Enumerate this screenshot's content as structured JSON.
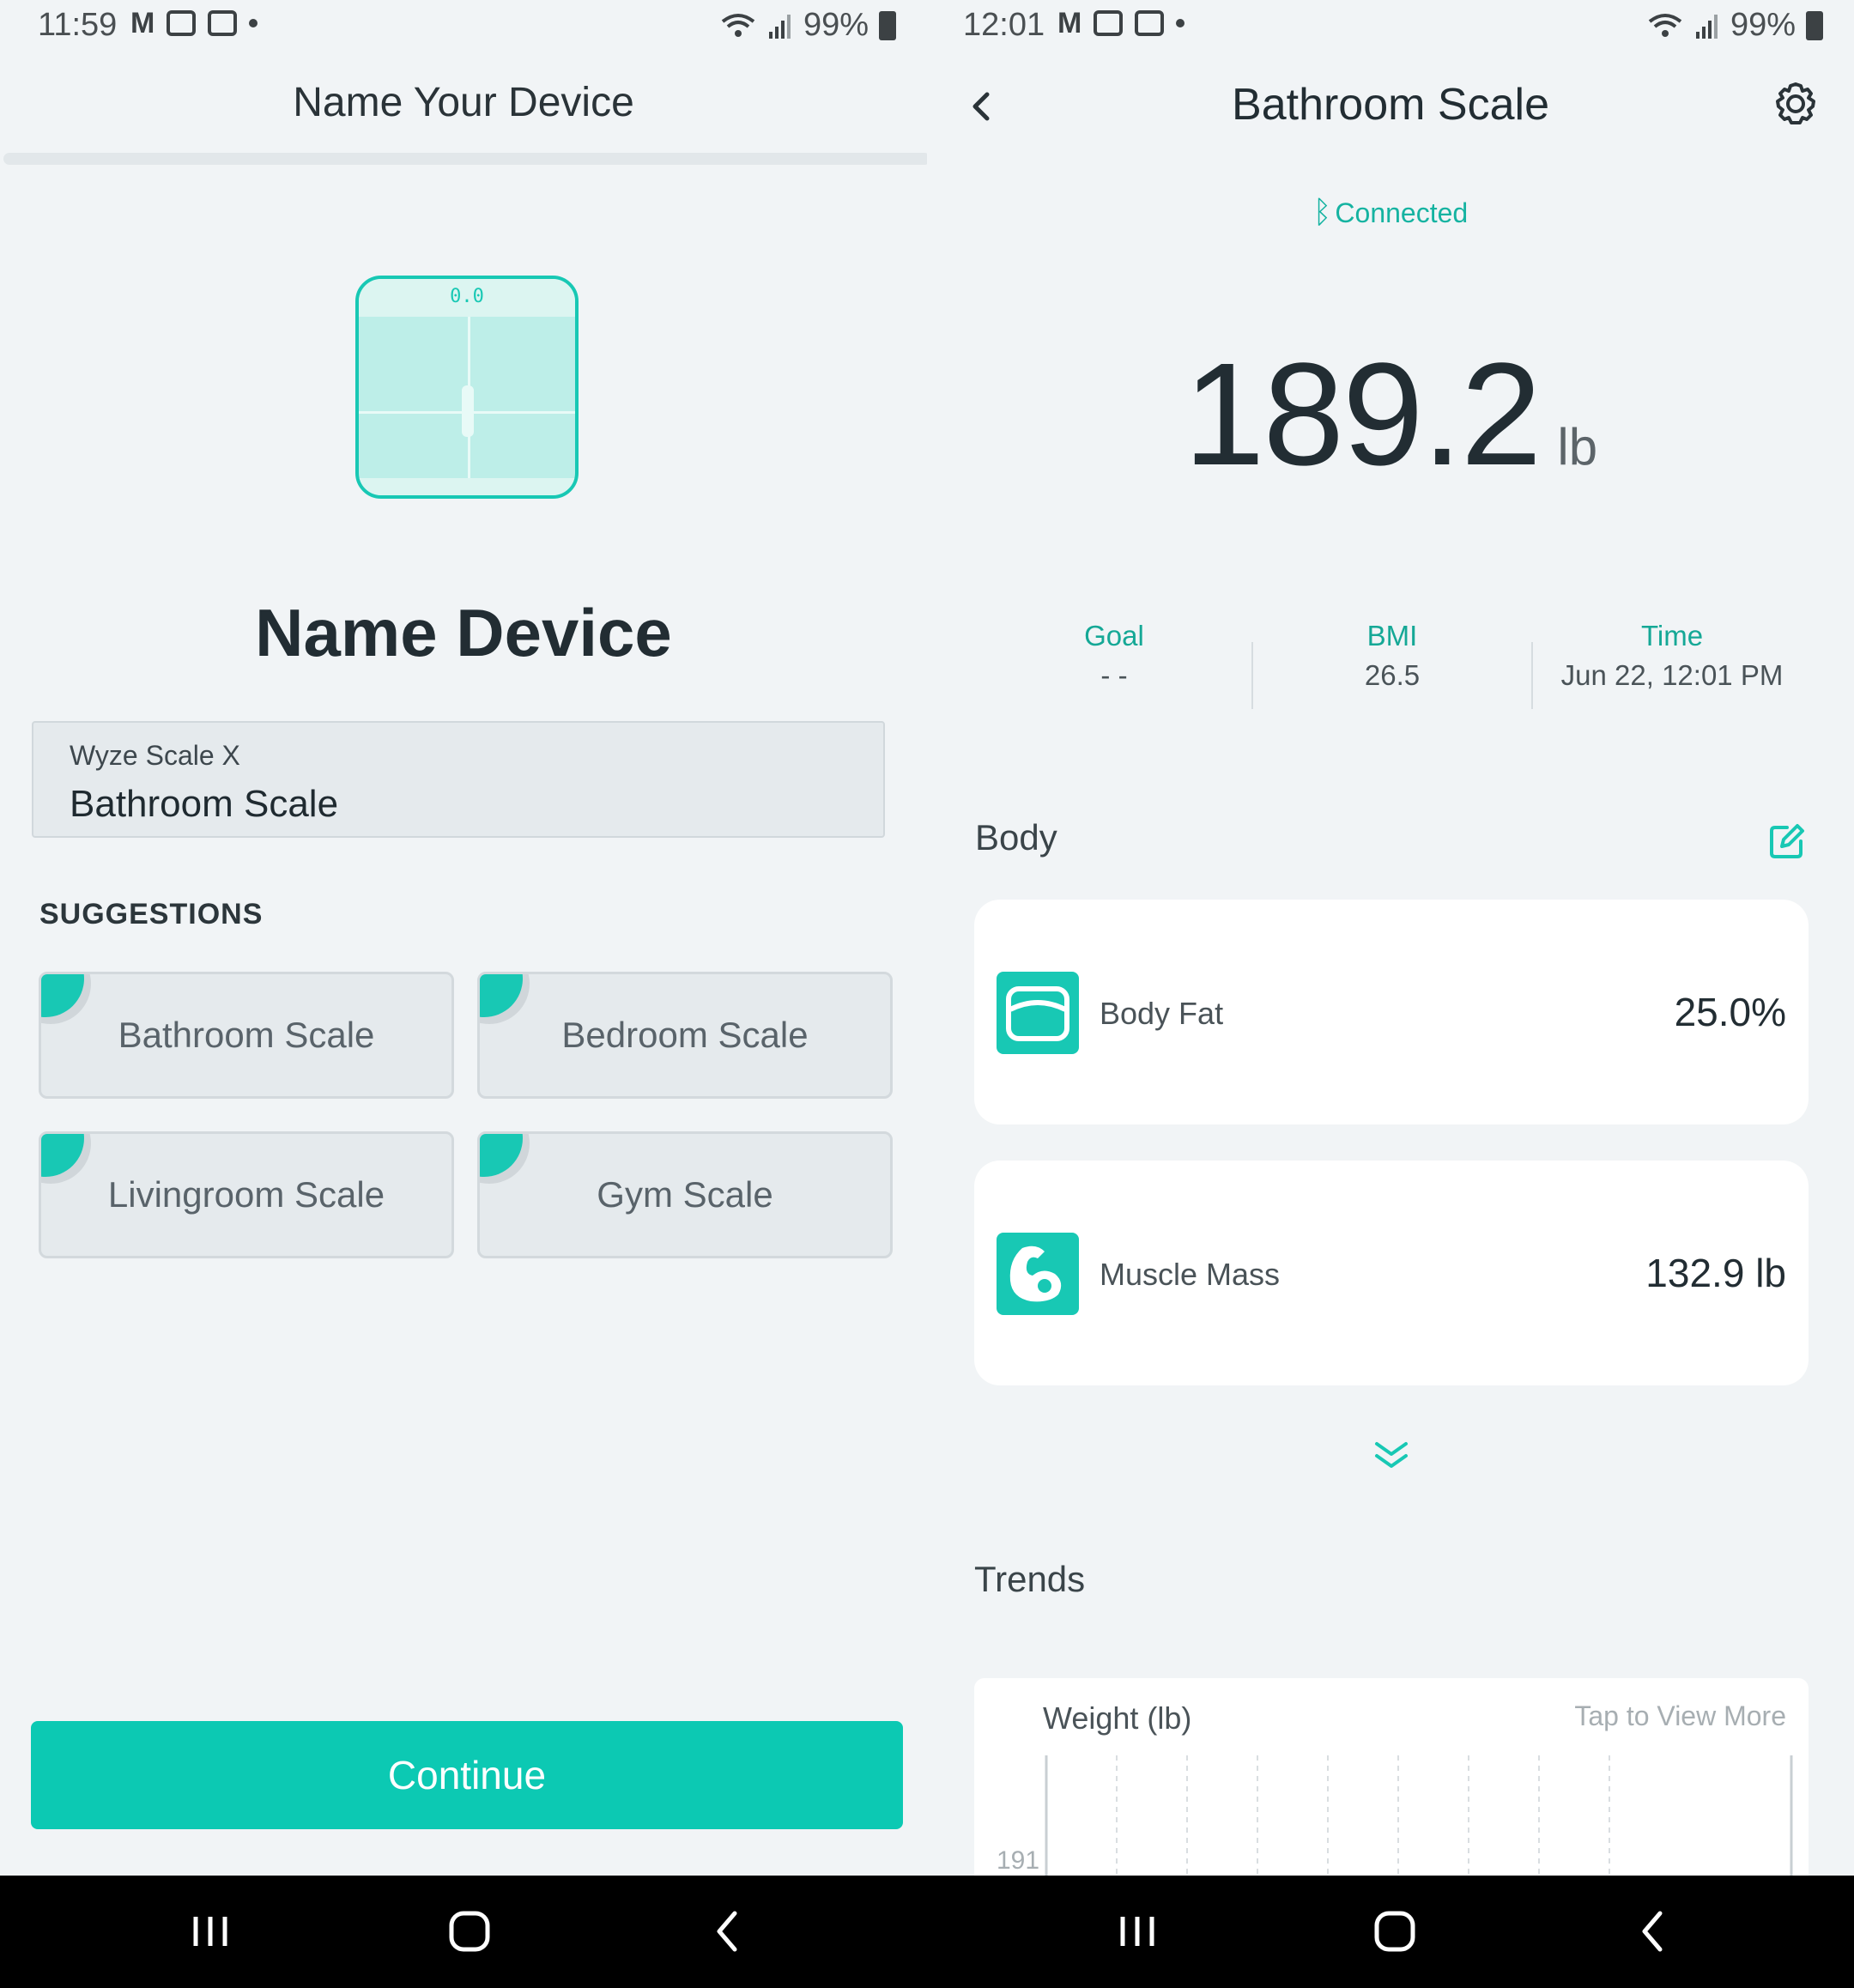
{
  "left": {
    "status": {
      "time": "11:59",
      "battery": "99%"
    },
    "header": {
      "title": "Name Your Device"
    },
    "scale_display": "0.0",
    "main_title": "Name Device",
    "input": {
      "label": "Wyze Scale X",
      "value": "Bathroom Scale"
    },
    "suggestions": {
      "heading": "SUGGESTIONS",
      "items": [
        "Bathroom Scale",
        "Bedroom Scale",
        "Livingroom Scale",
        "Gym Scale"
      ]
    },
    "continue_label": "Continue"
  },
  "right": {
    "status": {
      "time": "12:01",
      "battery": "99%"
    },
    "header": {
      "title": "Bathroom Scale"
    },
    "connection": "Connected",
    "weight": {
      "value": "189.2",
      "unit": "lb"
    },
    "stats": [
      {
        "label": "Goal",
        "value": "- -"
      },
      {
        "label": "BMI",
        "value": "26.5"
      },
      {
        "label": "Time",
        "value": "Jun 22, 12:01 PM"
      }
    ],
    "body": {
      "heading": "Body",
      "cards": [
        {
          "label": "Body Fat",
          "value": "25.0%",
          "icon": "body-fat-icon"
        },
        {
          "label": "Muscle Mass",
          "value": "132.9 lb",
          "icon": "muscle-icon"
        }
      ]
    },
    "trends": {
      "heading": "Trends",
      "chart_title": "Weight (lb)",
      "link": "Tap to View More",
      "y_tick": "191"
    }
  },
  "colors": {
    "accent": "#18c8b4",
    "button": "#0cc9b3",
    "background": "#f1f4f6"
  }
}
